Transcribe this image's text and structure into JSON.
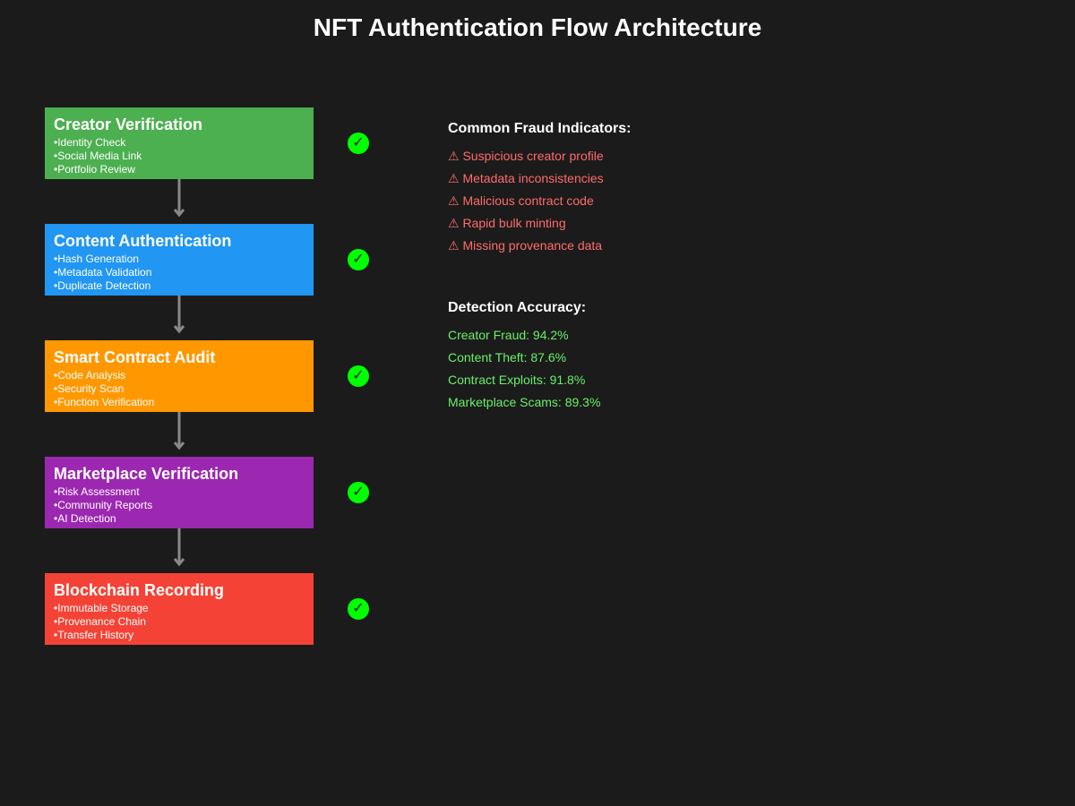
{
  "title": "NFT Authentication Flow Architecture",
  "steps": [
    {
      "title": "Creator Verification",
      "color": "#4caf50",
      "items": [
        "Identity Check",
        "Social Media Link",
        "Portfolio Review"
      ],
      "status_icon": "check-circle-icon"
    },
    {
      "title": "Content Authentication",
      "color": "#2196f3",
      "items": [
        "Hash Generation",
        "Metadata Validation",
        "Duplicate Detection"
      ],
      "status_icon": "check-circle-icon"
    },
    {
      "title": "Smart Contract Audit",
      "color": "#ff9800",
      "items": [
        "Code Analysis",
        "Security Scan",
        "Function Verification"
      ],
      "status_icon": "check-circle-icon"
    },
    {
      "title": "Marketplace Verification",
      "color": "#9c27b0",
      "items": [
        "Risk Assessment",
        "Community Reports",
        "AI Detection"
      ],
      "status_icon": "check-circle-icon"
    },
    {
      "title": "Blockchain Recording",
      "color": "#f44336",
      "items": [
        "Immutable Storage",
        "Provenance Chain",
        "Transfer History"
      ],
      "status_icon": "check-circle-icon"
    }
  ],
  "check_glyph": "✓",
  "check_color": "#00ff00",
  "arrow_color": "#888888",
  "fraud": {
    "heading": "Common Fraud Indicators:",
    "color": "#ff6b6b",
    "items": [
      "⚠ Suspicious creator profile",
      "⚠ Metadata inconsistencies",
      "⚠ Malicious contract code",
      "⚠ Rapid bulk minting",
      "⚠ Missing provenance data"
    ]
  },
  "accuracy": {
    "heading": "Detection Accuracy:",
    "color": "#69f069",
    "items": [
      "Creator Fraud: 94.2%",
      "Content Theft: 87.6%",
      "Contract Exploits: 91.8%",
      "Marketplace Scams: 89.3%"
    ]
  }
}
